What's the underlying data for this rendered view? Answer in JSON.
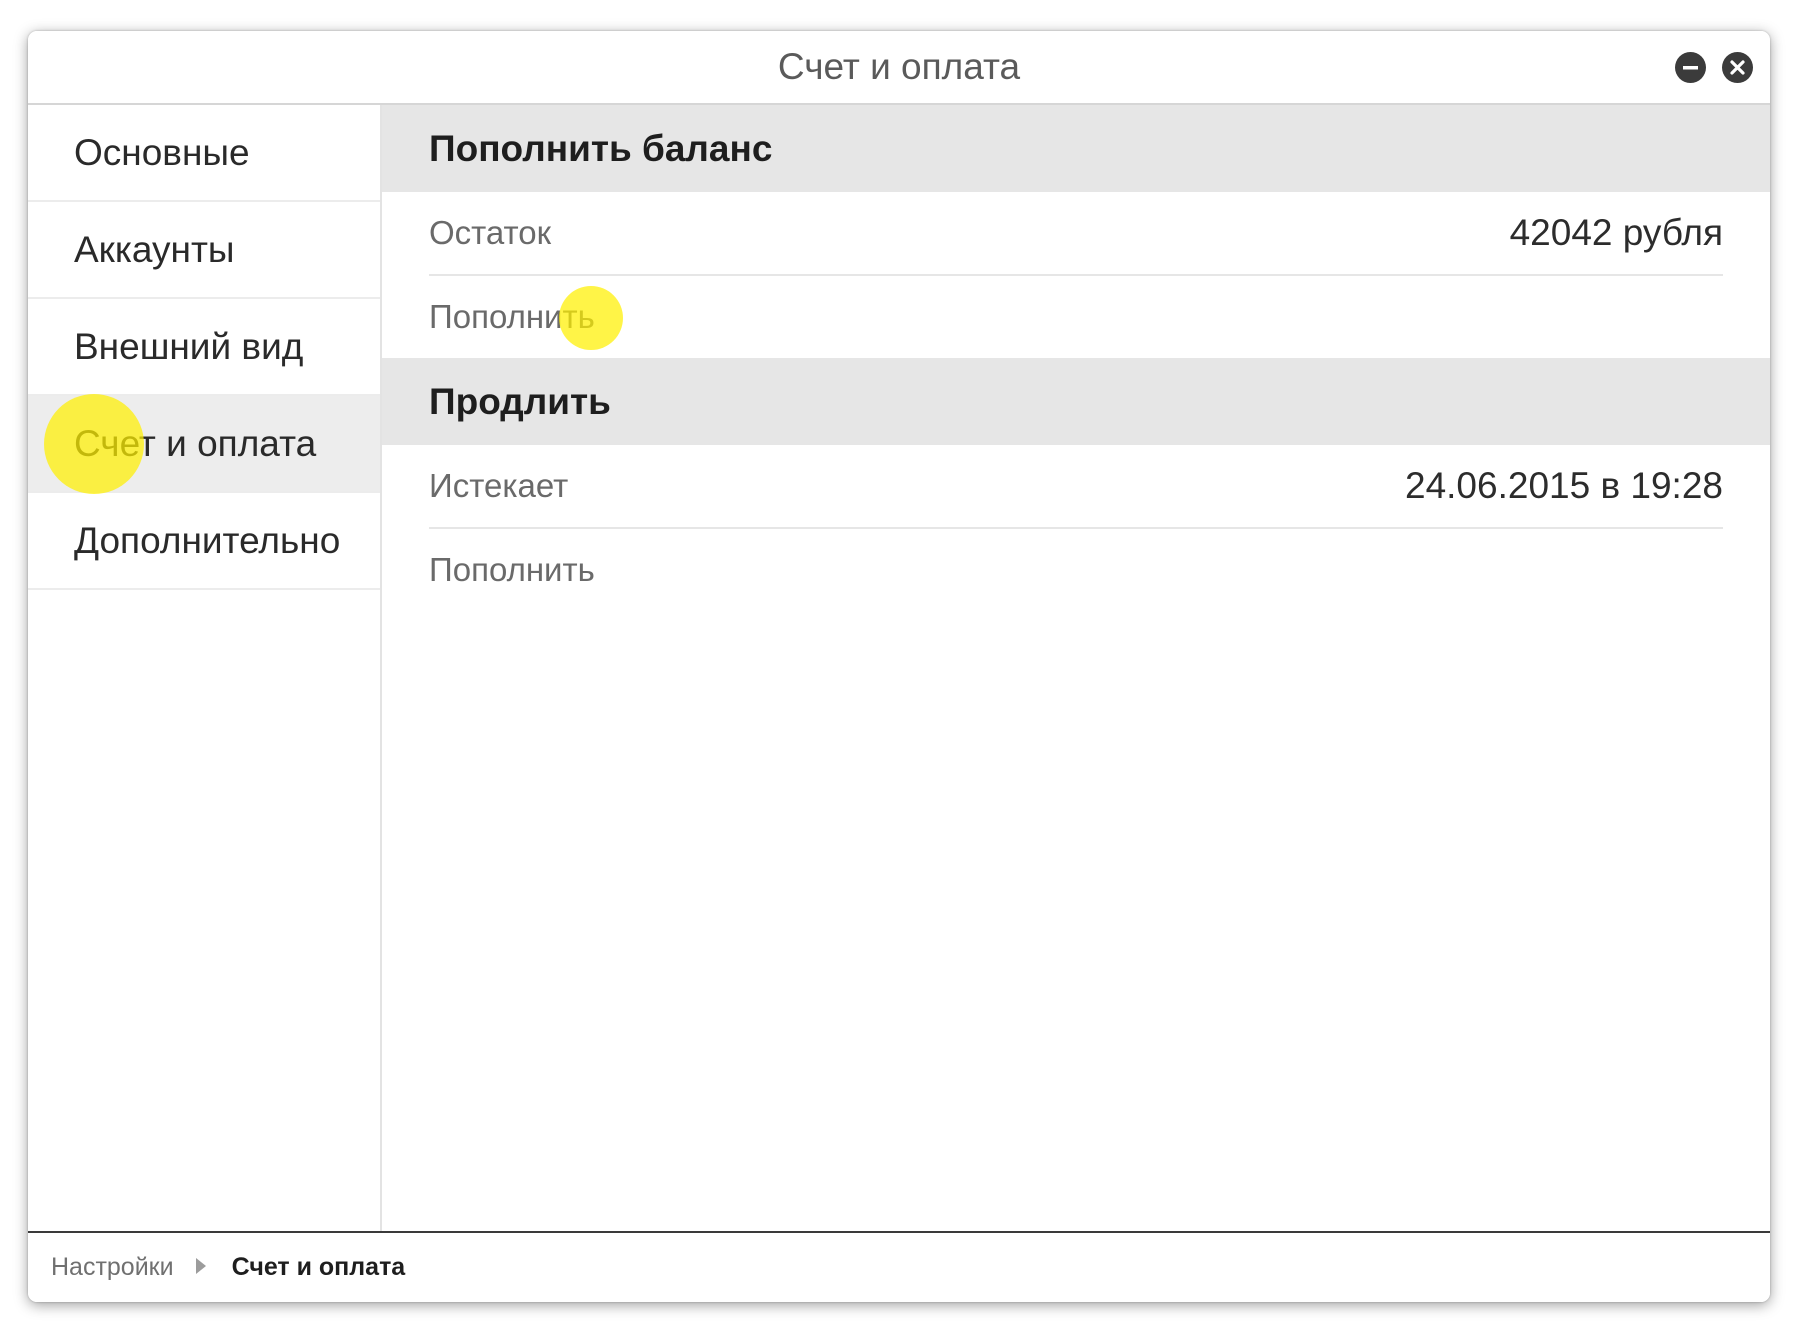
{
  "window": {
    "title": "Счет и оплата"
  },
  "sidebar": {
    "items": [
      {
        "label": "Основные"
      },
      {
        "label": "Аккаунты"
      },
      {
        "label": "Внешний вид"
      },
      {
        "label": "Счет и оплата",
        "active": true
      },
      {
        "label": "Дополнительно"
      }
    ]
  },
  "sections": [
    {
      "title": "Пополнить баланс",
      "row_label": "Остаток",
      "row_value": "42042 рубля",
      "action_label": "Пополнить"
    },
    {
      "title": "Продлить",
      "row_label": "Истекает",
      "row_value": "24.06.2015 в 19:28",
      "action_label": "Пополнить"
    }
  ],
  "breadcrumb": {
    "root": "Настройки",
    "current": "Счет и оплата"
  },
  "icons": {
    "minimize": "minimize-icon",
    "close": "close-icon",
    "separator": "triangle-right-icon"
  },
  "colors": {
    "highlight": "#fff000",
    "section_header_bg": "#e6e6e6",
    "active_nav_bg": "#ededed"
  }
}
